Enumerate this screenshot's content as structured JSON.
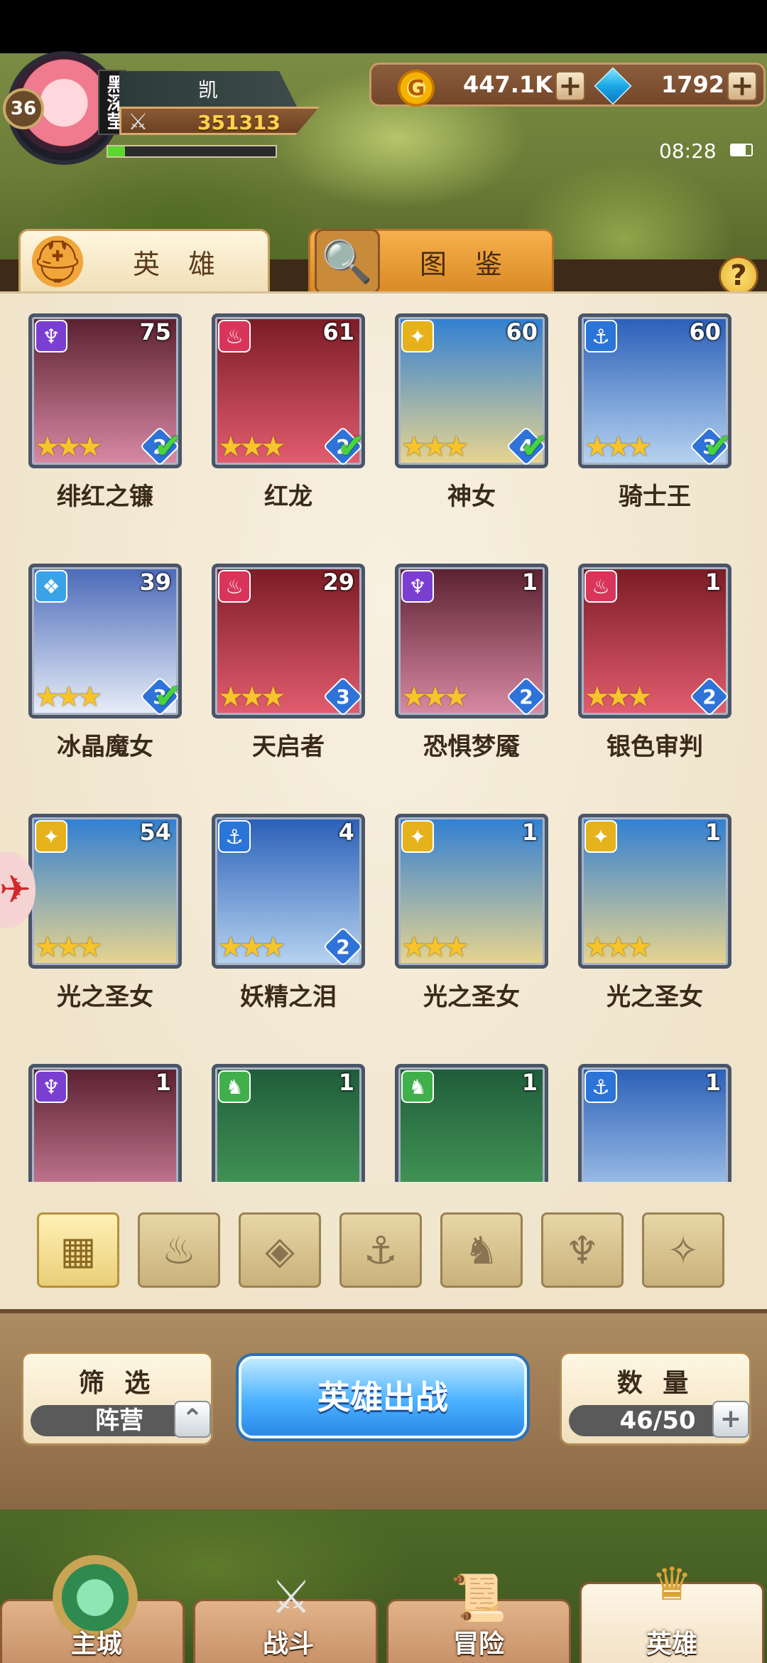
{
  "header": {
    "player_name": "凯",
    "player_tag": "黑深莹",
    "level": "36",
    "power": "351313",
    "exp_fraction": 0.1,
    "gold": "447.1K",
    "gems": "1792",
    "time": "08:28"
  },
  "tabs": [
    {
      "label": "英 雄",
      "icon": "knight-helmet-icon"
    },
    {
      "label": "图 鉴",
      "icon": "magnifier-book-icon"
    }
  ],
  "help": "?",
  "heroes": [
    {
      "name": "绯红之镰",
      "level": "75",
      "faction": "dark",
      "stars": "★★★",
      "rank": "2",
      "checked": true
    },
    {
      "name": "红龙",
      "level": "61",
      "faction": "fire",
      "stars": "★★★",
      "rank": "2",
      "checked": true
    },
    {
      "name": "神女",
      "level": "60",
      "faction": "light",
      "stars": "★★★",
      "rank": "4",
      "checked": true
    },
    {
      "name": "骑士王",
      "level": "60",
      "faction": "water",
      "stars": "★★★",
      "rank": "3",
      "checked": true
    },
    {
      "name": "冰晶魔女",
      "level": "39",
      "faction": "ice",
      "stars": "★★★",
      "rank": "3",
      "checked": true
    },
    {
      "name": "天启者",
      "level": "29",
      "faction": "fire",
      "stars": "★★★",
      "rank": "3",
      "checked": false
    },
    {
      "name": "恐惧梦魇",
      "level": "1",
      "faction": "dark",
      "stars": "★★★",
      "rank": "2",
      "checked": false
    },
    {
      "name": "银色审判",
      "level": "1",
      "faction": "fire",
      "stars": "★★★",
      "rank": "2",
      "checked": false
    },
    {
      "name": "光之圣女",
      "level": "54",
      "faction": "light",
      "stars": "★★★",
      "rank": "",
      "checked": false
    },
    {
      "name": "妖精之泪",
      "level": "4",
      "faction": "water",
      "stars": "★★★",
      "rank": "2",
      "checked": false
    },
    {
      "name": "光之圣女",
      "level": "1",
      "faction": "light",
      "stars": "★★★",
      "rank": "",
      "checked": false
    },
    {
      "name": "光之圣女",
      "level": "1",
      "faction": "light",
      "stars": "★★★",
      "rank": "",
      "checked": false
    },
    {
      "name": "",
      "level": "1",
      "faction": "dark",
      "stars": "",
      "rank": "",
      "checked": false
    },
    {
      "name": "",
      "level": "1",
      "faction": "beast",
      "stars": "",
      "rank": "",
      "checked": false
    },
    {
      "name": "",
      "level": "1",
      "faction": "beast",
      "stars": "",
      "rank": "",
      "checked": false
    },
    {
      "name": "",
      "level": "1",
      "faction": "water",
      "stars": "",
      "rank": "",
      "checked": false
    }
  ],
  "faction_colors": {
    "dark": "#7a3fd1",
    "fire": "#d9345a",
    "light": "#e6b21c",
    "water": "#2b74d8",
    "ice": "#3aa3e8",
    "beast": "#3fb04a"
  },
  "filter_icons": [
    "all-grid-icon",
    "fire-filter-icon",
    "ice-filter-icon",
    "anchor-filter-icon",
    "beast-filter-icon",
    "dark-filter-icon",
    "light-filter-icon"
  ],
  "filter_box": {
    "title": "筛 选",
    "value": "阵营"
  },
  "deploy_button": "英雄出战",
  "count_box": {
    "title": "数 量",
    "value": "46/50"
  },
  "nav": [
    {
      "label": "主城",
      "icon": "castle-icon"
    },
    {
      "label": "战斗",
      "icon": "crossed-swords-icon"
    },
    {
      "label": "冒险",
      "icon": "map-scroll-icon"
    },
    {
      "label": "英雄",
      "icon": "hero-crest-icon"
    }
  ]
}
